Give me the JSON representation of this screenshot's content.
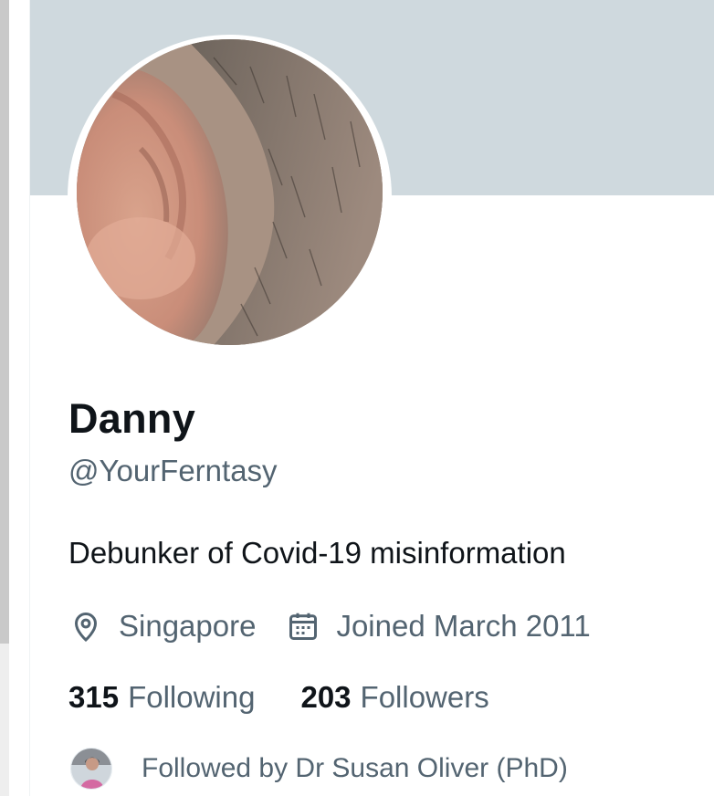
{
  "profile": {
    "display_name": "Danny",
    "handle": "@YourFerntasy",
    "bio": "Debunker of Covid-19 misinformation",
    "location": "Singapore",
    "joined": "Joined March 2011",
    "following_count": "315",
    "following_label": "Following",
    "followers_count": "203",
    "followers_label": "Followers",
    "followed_by": "Followed by Dr Susan Oliver (PhD)"
  },
  "icons": {
    "location": "location-pin-icon",
    "calendar": "calendar-icon"
  },
  "colors": {
    "banner": "#cfd9de",
    "primary_text": "#0f1419",
    "secondary_text": "#536471"
  }
}
